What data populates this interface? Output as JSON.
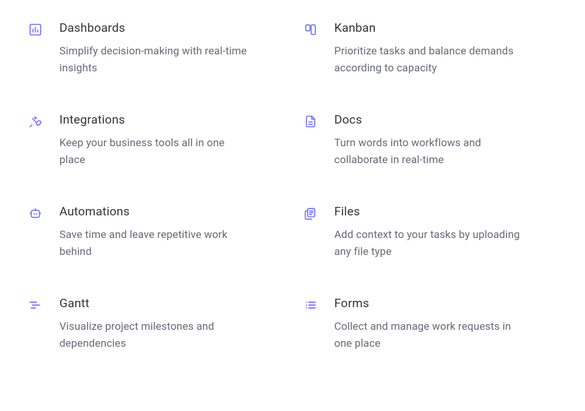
{
  "features": [
    {
      "title": "Dashboards",
      "desc": "Simplify decision-making with real-time insights"
    },
    {
      "title": "Kanban",
      "desc": "Prioritize tasks and balance demands according to capacity"
    },
    {
      "title": "Integrations",
      "desc": "Keep your business tools all in one place"
    },
    {
      "title": "Docs",
      "desc": "Turn words into workflows and collaborate in real-time"
    },
    {
      "title": "Automations",
      "desc": "Save time and leave repetitive work behind"
    },
    {
      "title": "Files",
      "desc": "Add context to your tasks by uploading any file type"
    },
    {
      "title": "Gantt",
      "desc": "Visualize project milestones and dependencies"
    },
    {
      "title": "Forms",
      "desc": "Collect and manage work requests in one place"
    }
  ]
}
